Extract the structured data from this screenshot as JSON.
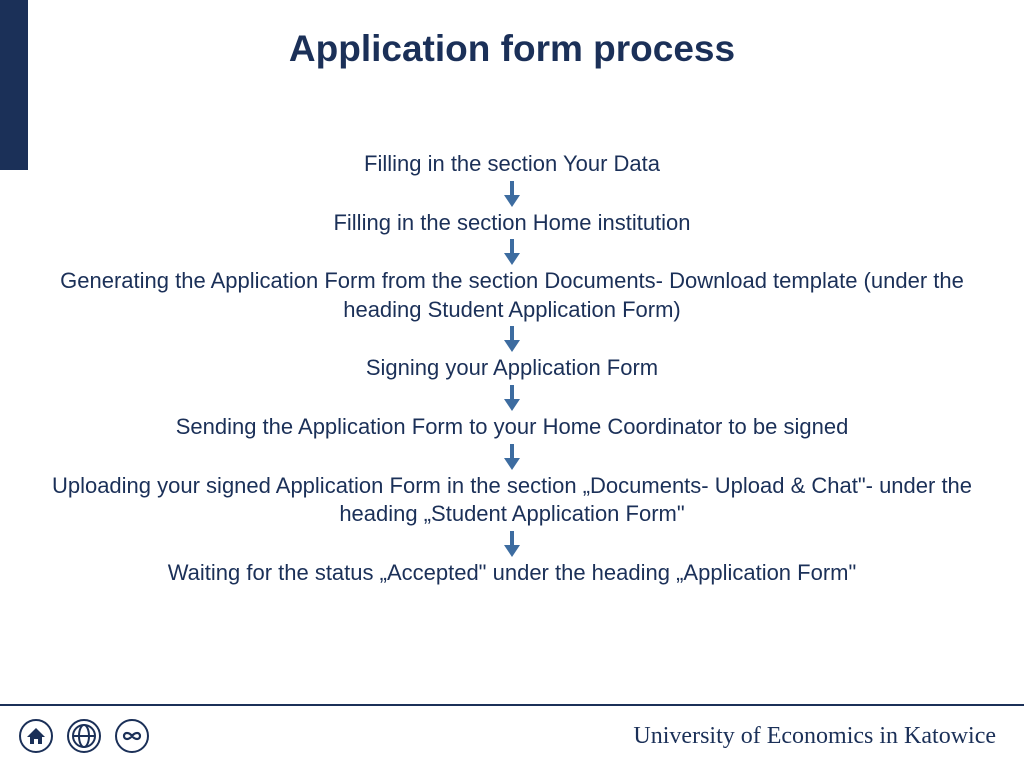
{
  "title": "Application form process",
  "steps": [
    "Filling in the section Your Data",
    "Filling in the section Home institution",
    "Generating the Application Form from the section Documents- Download template (under the heading Student Application Form)",
    "Signing your Application Form",
    "Sending the Application Form to your Home Coordinator to be signed",
    "Uploading your signed Application Form in the section „Documents- Upload & Chat\"- under the heading „Student Application Form\"",
    "Waiting for the status „Accepted\" under the heading „Application Form\""
  ],
  "footer": {
    "university": "University of Economics in Katowice"
  },
  "colors": {
    "primary": "#1b3058",
    "arrow": "#3d6ca0"
  }
}
